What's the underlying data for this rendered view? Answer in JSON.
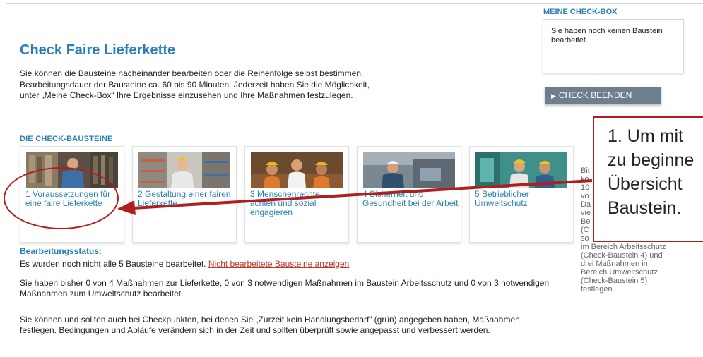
{
  "page": {
    "title": "Check Faire Lieferkette",
    "intro": "Sie können die Bausteine nacheinander bearbeiten oder die Reihenfolge selbst bestimmen. Bearbeitungsdauer der Bausteine ca. 60 bis 90 Minuten. Jederzeit haben Sie die Möglichkeit, unter „Meine Check-Box“ Ihre Ergebnisse einzusehen und Ihre Maßnahmen festzulegen.",
    "section_heading": "DIE CHECK-BAUSTEINE"
  },
  "modules": [
    {
      "label": "1 Voraussetzungen für eine faire Lieferkette"
    },
    {
      "label": "2 Gestaltung einer fairen Lieferkette"
    },
    {
      "label": "3 Menschenrechte achten und sozial engagieren"
    },
    {
      "label": "4 Sicherheit und Gesundheit bei der Arbeit"
    },
    {
      "label": "5 Betrieblicher Umweltschutz"
    }
  ],
  "status": {
    "heading": "Bearbeitungsstatus:",
    "line1": "Es wurden noch nicht alle 5 Bausteine bearbeitet.",
    "link": "Nicht bearbeitete Bausteine anzeigen",
    "line2": "Sie haben bisher 0 von 4 Maßnahmen zur Lieferkette, 0 von 3 notwendigen Maßnahmen im Baustein Arbeitsschutz und 0 von 3 notwendigen Maßnahmen zum Umweltschutz bearbeitet.",
    "line3": "Sie können und sollten auch bei Checkpunkten, bei denen Sie „Zurzeit kein Handlungsbedarf“ (grün) angegeben haben, Maßnahmen festlegen. Bedingungen und Abläufe verändern sich in der Zeit und sollten überprüft sowie angepasst und verbessert werden."
  },
  "sidebar": {
    "title": "MEINE CHECK-BOX",
    "box_text": "Sie haben noch keinen Baustein bearbeitet.",
    "end_button": "CHECK BEENDEN",
    "side_text_lines": [
      "Bit",
      "ko",
      "10",
      "vo",
      "Da",
      "vie",
      "Be",
      "(C",
      "so",
      "im Bereich Arbeitsschutz",
      "(Check-Baustein 4) und",
      "drei Maßnahmen im",
      "Bereich Umweltschutz",
      "(Check-Baustein 5)",
      "festlegen."
    ]
  },
  "callout": {
    "lines": [
      "1. Um mit",
      "zu beginne",
      "Übersicht",
      "Baustein."
    ]
  },
  "colors": {
    "accent_blue": "#2a7fb8",
    "annotation_red": "#b01e1e",
    "button_gray": "#6d7e8f"
  }
}
